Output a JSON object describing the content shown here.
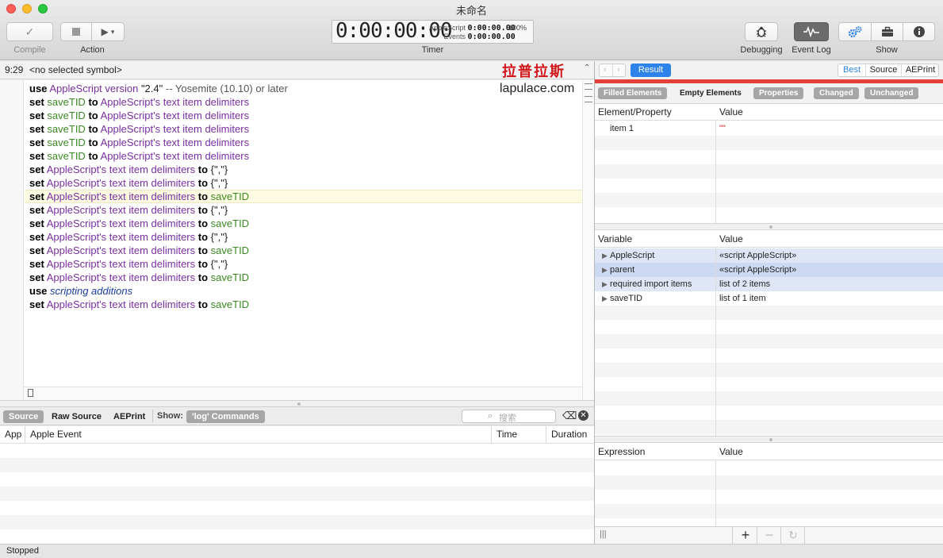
{
  "window": {
    "title": "未命名"
  },
  "toolbar": {
    "compile_label": "Compile",
    "action_label": "Action",
    "timer_label": "Timer",
    "debugging_label": "Debugging",
    "eventlog_label": "Event Log",
    "show_label": "Show"
  },
  "timer": {
    "main": "0:00:00:00",
    "applescript_label": "AppleScript",
    "applescript_time": "0:00:00.00",
    "events_label": "Events",
    "events_time": "0:00:00.00",
    "percent": "100%"
  },
  "navbar": {
    "position": "9:29",
    "symbol": "<no selected symbol>",
    "watermark": "拉普拉斯",
    "watermark_url": "lapulace.com"
  },
  "code": {
    "lines": [
      [
        [
          "kw",
          "use"
        ],
        [
          "plain",
          " "
        ],
        [
          "cls",
          "AppleScript version"
        ],
        [
          "plain",
          " "
        ],
        [
          "str",
          "\"2.4\""
        ],
        [
          "plain",
          " "
        ],
        [
          "cmt",
          "-- Yosemite (10.10) or later"
        ]
      ],
      [
        [
          "kw",
          "set"
        ],
        [
          "plain",
          " "
        ],
        [
          "var",
          "saveTID"
        ],
        [
          "plain",
          " "
        ],
        [
          "kw",
          "to"
        ],
        [
          "plain",
          " "
        ],
        [
          "cls",
          "AppleScript's text item delimiters"
        ]
      ],
      [
        [
          "kw",
          "set"
        ],
        [
          "plain",
          " "
        ],
        [
          "var",
          "saveTID"
        ],
        [
          "plain",
          " "
        ],
        [
          "kw",
          "to"
        ],
        [
          "plain",
          " "
        ],
        [
          "cls",
          "AppleScript's text item delimiters"
        ]
      ],
      [
        [
          "kw",
          "set"
        ],
        [
          "plain",
          " "
        ],
        [
          "var",
          "saveTID"
        ],
        [
          "plain",
          " "
        ],
        [
          "kw",
          "to"
        ],
        [
          "plain",
          " "
        ],
        [
          "cls",
          "AppleScript's text item delimiters"
        ]
      ],
      [
        [
          "kw",
          "set"
        ],
        [
          "plain",
          " "
        ],
        [
          "var",
          "saveTID"
        ],
        [
          "plain",
          " "
        ],
        [
          "kw",
          "to"
        ],
        [
          "plain",
          " "
        ],
        [
          "cls",
          "AppleScript's text item delimiters"
        ]
      ],
      [
        [
          "kw",
          "set"
        ],
        [
          "plain",
          " "
        ],
        [
          "var",
          "saveTID"
        ],
        [
          "plain",
          " "
        ],
        [
          "kw",
          "to"
        ],
        [
          "plain",
          " "
        ],
        [
          "cls",
          "AppleScript's text item delimiters"
        ]
      ],
      [
        [
          "kw",
          "set"
        ],
        [
          "plain",
          " "
        ],
        [
          "cls",
          "AppleScript's text item delimiters"
        ],
        [
          "plain",
          " "
        ],
        [
          "kw",
          "to"
        ],
        [
          "plain",
          " "
        ],
        [
          "str",
          "{\",\"}"
        ]
      ],
      [
        [
          "kw",
          "set"
        ],
        [
          "plain",
          " "
        ],
        [
          "cls",
          "AppleScript's text item delimiters"
        ],
        [
          "plain",
          " "
        ],
        [
          "kw",
          "to"
        ],
        [
          "plain",
          " "
        ],
        [
          "str",
          "{\",\"}"
        ]
      ],
      [
        [
          "kw",
          "set"
        ],
        [
          "plain",
          " "
        ],
        [
          "cls",
          "AppleScript's text item delimiters"
        ],
        [
          "plain",
          " "
        ],
        [
          "kw",
          "to"
        ],
        [
          "plain",
          " "
        ],
        [
          "var",
          "saveTID"
        ]
      ],
      [
        [
          "kw",
          "set"
        ],
        [
          "plain",
          " "
        ],
        [
          "cls",
          "AppleScript's text item delimiters"
        ],
        [
          "plain",
          " "
        ],
        [
          "kw",
          "to"
        ],
        [
          "plain",
          " "
        ],
        [
          "str",
          "{\",\"}"
        ]
      ],
      [
        [
          "kw",
          "set"
        ],
        [
          "plain",
          " "
        ],
        [
          "cls",
          "AppleScript's text item delimiters"
        ],
        [
          "plain",
          " "
        ],
        [
          "kw",
          "to"
        ],
        [
          "plain",
          " "
        ],
        [
          "var",
          "saveTID"
        ]
      ],
      [
        [
          "kw",
          "set"
        ],
        [
          "plain",
          " "
        ],
        [
          "cls",
          "AppleScript's text item delimiters"
        ],
        [
          "plain",
          " "
        ],
        [
          "kw",
          "to"
        ],
        [
          "plain",
          " "
        ],
        [
          "str",
          "{\",\"}"
        ]
      ],
      [
        [
          "kw",
          "set"
        ],
        [
          "plain",
          " "
        ],
        [
          "cls",
          "AppleScript's text item delimiters"
        ],
        [
          "plain",
          " "
        ],
        [
          "kw",
          "to"
        ],
        [
          "plain",
          " "
        ],
        [
          "var",
          "saveTID"
        ]
      ],
      [
        [
          "kw",
          "set"
        ],
        [
          "plain",
          " "
        ],
        [
          "cls",
          "AppleScript's text item delimiters"
        ],
        [
          "plain",
          " "
        ],
        [
          "kw",
          "to"
        ],
        [
          "plain",
          " "
        ],
        [
          "str",
          "{\",\"}"
        ]
      ],
      [
        [
          "kw",
          "set"
        ],
        [
          "plain",
          " "
        ],
        [
          "cls",
          "AppleScript's text item delimiters"
        ],
        [
          "plain",
          " "
        ],
        [
          "kw",
          "to"
        ],
        [
          "plain",
          " "
        ],
        [
          "var",
          "saveTID"
        ]
      ],
      [
        [
          "kw",
          "use"
        ],
        [
          "plain",
          " "
        ],
        [
          "ital",
          "scripting additions"
        ]
      ],
      [
        [
          "kw",
          "set"
        ],
        [
          "plain",
          " "
        ],
        [
          "cls",
          "AppleScript's text item delimiters"
        ],
        [
          "plain",
          " "
        ],
        [
          "kw",
          "to"
        ],
        [
          "plain",
          " "
        ],
        [
          "var",
          "saveTID"
        ]
      ]
    ]
  },
  "log": {
    "tabs": [
      "Source",
      "Raw Source",
      "AEPrint"
    ],
    "show_label": "Show:",
    "filter_pill": "'log' Commands",
    "search_placeholder": "搜索",
    "columns": [
      "App",
      "Apple Event",
      "Time",
      "Duration"
    ]
  },
  "status": "Stopped",
  "result": {
    "result_button": "Result",
    "view_tabs": [
      "Best",
      "Source",
      "AEPrint"
    ],
    "element_tabs": [
      "Filled Elements",
      "Empty Elements",
      "Properties",
      "Changed",
      "Unchanged"
    ],
    "elements_columns": [
      "Element/Property",
      "Value"
    ],
    "elements": [
      {
        "name": "item 1",
        "value": "\"\""
      }
    ],
    "variables_columns": [
      "Variable",
      "Value"
    ],
    "variables": [
      {
        "name": "AppleScript",
        "value": "«script AppleScript»"
      },
      {
        "name": "parent",
        "value": "«script AppleScript»"
      },
      {
        "name": "required import items",
        "value": "list of 2 items"
      },
      {
        "name": "saveTID",
        "value": "list of 1 item"
      }
    ],
    "expression_columns": [
      "Expression",
      "Value"
    ]
  },
  "colors": {
    "accent": "#2d83e9",
    "keyword": "#000000",
    "class": "#7a2fa0",
    "variable": "#3b8a23",
    "watermark": "#d0161b"
  }
}
